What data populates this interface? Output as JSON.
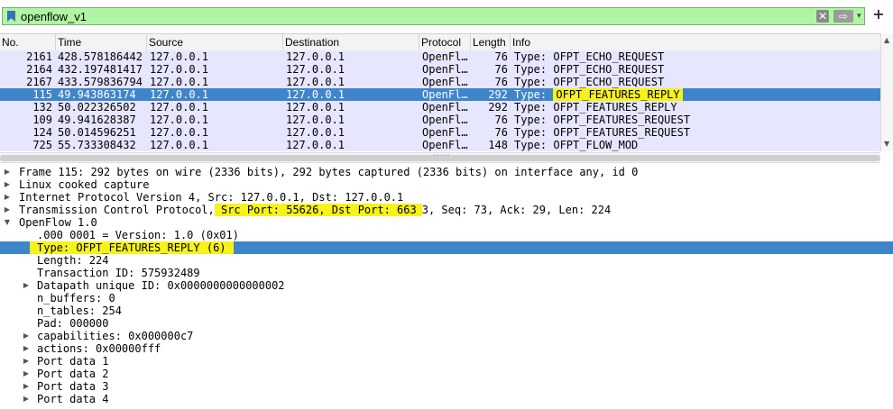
{
  "filter": {
    "value": "openflow_v1",
    "clear_glyph": "✕",
    "apply_glyph": "⇨",
    "history_glyph": "▾",
    "add_glyph": "+"
  },
  "columns": [
    "No.",
    "Time",
    "Source",
    "Destination",
    "Protocol",
    "Length",
    "Info"
  ],
  "packets": [
    {
      "no": "2161",
      "time": "428.578186442",
      "source": "127.0.0.1",
      "destination": "127.0.0.1",
      "protocol": "OpenFl…",
      "length": "76",
      "info_prefix": "Type: ",
      "info_type": "OFPT_ECHO_REQUEST",
      "selected": false
    },
    {
      "no": "2164",
      "time": "432.197481417",
      "source": "127.0.0.1",
      "destination": "127.0.0.1",
      "protocol": "OpenFl…",
      "length": "76",
      "info_prefix": "Type: ",
      "info_type": "OFPT_ECHO_REQUEST",
      "selected": false
    },
    {
      "no": "2167",
      "time": "433.579836794",
      "source": "127.0.0.1",
      "destination": "127.0.0.1",
      "protocol": "OpenFl…",
      "length": "76",
      "info_prefix": "Type: ",
      "info_type": "OFPT_ECHO_REQUEST",
      "selected": false
    },
    {
      "no": "115",
      "time": "49.943863174",
      "source": "127.0.0.1",
      "destination": "127.0.0.1",
      "protocol": "OpenFl…",
      "length": "292",
      "info_prefix": "Type: ",
      "info_type": "OFPT_FEATURES_REPLY",
      "selected": true
    },
    {
      "no": "132",
      "time": "50.022326502",
      "source": "127.0.0.1",
      "destination": "127.0.0.1",
      "protocol": "OpenFl…",
      "length": "292",
      "info_prefix": "Type: ",
      "info_type": "OFPT_FEATURES_REPLY",
      "selected": false
    },
    {
      "no": "109",
      "time": "49.941628387",
      "source": "127.0.0.1",
      "destination": "127.0.0.1",
      "protocol": "OpenFl…",
      "length": "76",
      "info_prefix": "Type: ",
      "info_type": "OFPT_FEATURES_REQUEST",
      "selected": false
    },
    {
      "no": "124",
      "time": "50.014596251",
      "source": "127.0.0.1",
      "destination": "127.0.0.1",
      "protocol": "OpenFl…",
      "length": "76",
      "info_prefix": "Type: ",
      "info_type": "OFPT_FEATURES_REQUEST",
      "selected": false
    },
    {
      "no": "725",
      "time": "55.733308432",
      "source": "127.0.0.1",
      "destination": "127.0.0.1",
      "protocol": "OpenFl…",
      "length": "148",
      "info_prefix": "Type: ",
      "info_type": "OFPT_FLOW_MOD",
      "selected": false
    }
  ],
  "scroll": {
    "up": "▲",
    "down": "▼",
    "left": "◀",
    "right": "▶",
    "splitter": "·····"
  },
  "details": [
    {
      "expander": "closed",
      "indent": 0,
      "text": "Frame 115: 292 bytes on wire (2336 bits), 292 bytes captured (2336 bits) on interface any, id 0"
    },
    {
      "expander": "closed",
      "indent": 0,
      "text": "Linux cooked capture"
    },
    {
      "expander": "closed",
      "indent": 0,
      "text": "Internet Protocol Version 4, Src: 127.0.0.1, Dst: 127.0.0.1"
    },
    {
      "expander": "closed",
      "indent": 0,
      "text": "Transmission Control Protocol,",
      "highlight": " Src Port: 55626, Dst Port: 663",
      "rest": "3, Seq: 73, Ack: 29, Len: 224"
    },
    {
      "expander": "open",
      "indent": 0,
      "text": "OpenFlow 1.0"
    },
    {
      "expander": "none",
      "indent": 1,
      "text": ".000 0001 = Version: 1.0 (0x01)"
    },
    {
      "expander": "none",
      "indent": 1,
      "text": "",
      "highlight": "Type: OFPT_FEATURES_REPLY (6)",
      "selected": true
    },
    {
      "expander": "none",
      "indent": 1,
      "text": "Length: 224"
    },
    {
      "expander": "none",
      "indent": 1,
      "text": "Transaction ID: 575932489"
    },
    {
      "expander": "closed",
      "indent": 1,
      "text": "Datapath unique ID: 0x0000000000000002"
    },
    {
      "expander": "none",
      "indent": 1,
      "text": "n_buffers: 0"
    },
    {
      "expander": "none",
      "indent": 1,
      "text": "n_tables: 254"
    },
    {
      "expander": "none",
      "indent": 1,
      "text": "Pad: 000000"
    },
    {
      "expander": "closed",
      "indent": 1,
      "text": "capabilities: 0x000000c7"
    },
    {
      "expander": "closed",
      "indent": 1,
      "text": "actions: 0x00000fff"
    },
    {
      "expander": "closed",
      "indent": 1,
      "text": "Port data 1"
    },
    {
      "expander": "closed",
      "indent": 1,
      "text": "Port data 2"
    },
    {
      "expander": "closed",
      "indent": 1,
      "text": "Port data 3"
    },
    {
      "expander": "closed",
      "indent": 1,
      "text": "Port data 4"
    }
  ],
  "colors": {
    "filter_valid": "#aff5a3",
    "row_openflow": "#e7e6ff",
    "selection": "#3f85c9",
    "highlight": "#f7f21a"
  }
}
